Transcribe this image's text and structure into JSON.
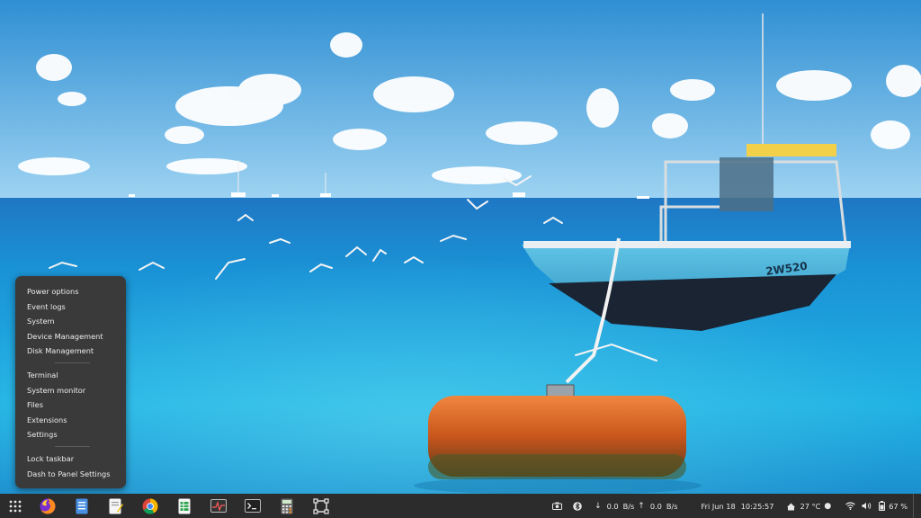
{
  "context_menu": {
    "group1": [
      "Power options",
      "Event logs",
      "System",
      "Device Management",
      "Disk Management"
    ],
    "group2": [
      "Terminal",
      "System monitor",
      "Files",
      "Extensions",
      "Settings"
    ],
    "group3": [
      "Lock taskbar",
      "Dash to Panel Settings"
    ]
  },
  "taskbar": {
    "apps": [
      "apps-grid-icon",
      "firefox-icon",
      "document-viewer-icon",
      "text-editor-icon",
      "chrome-icon",
      "spreadsheet-icon",
      "system-monitor-icon",
      "terminal-icon",
      "calculator-icon",
      "screenshot-tool-icon"
    ],
    "tray": {
      "download_speed": "0.0",
      "download_unit": "B/s",
      "upload_speed": "0.0",
      "upload_unit": "B/s",
      "date": "Fri Jun 18",
      "time": "10:25:57",
      "temperature": "27 °C",
      "battery": "67 %"
    }
  },
  "colors": {
    "taskbar_bg": "#2c2c2c",
    "menu_bg": "#3a3a3a",
    "sky": "#3f9fd9",
    "sea": "#1a9fd6",
    "buoy": "#e0631f"
  }
}
